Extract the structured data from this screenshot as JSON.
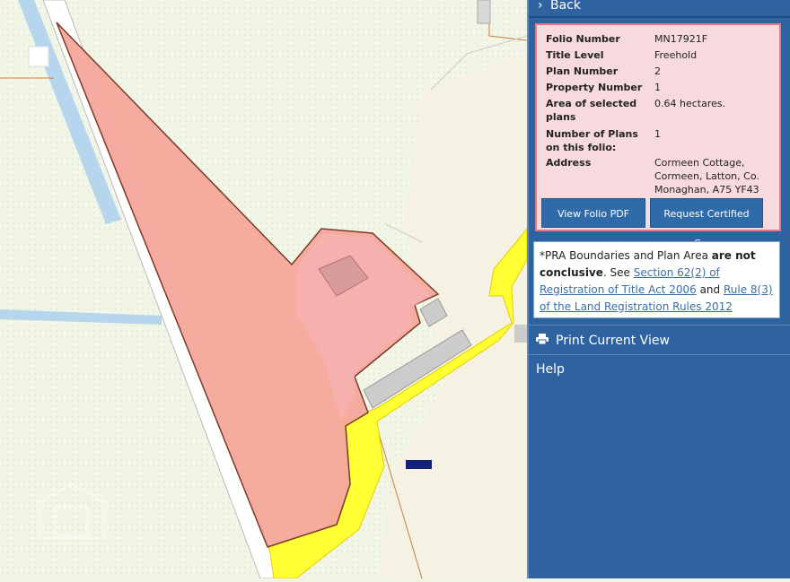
{
  "panel": {
    "back_label": "Back",
    "folio": [
      {
        "label": "Folio Number",
        "value": "MN17921F"
      },
      {
        "label": "Title Level",
        "value": "Freehold"
      },
      {
        "label": "Plan Number",
        "value": "2"
      },
      {
        "label": "Property Number",
        "value": "1"
      },
      {
        "label": "Area of selected plans",
        "value": "0.64 hectares."
      },
      {
        "label": "Number of Plans on this folio:",
        "value": "1"
      },
      {
        "label": "Address",
        "value": "Cormeen Cottage, Cormeen, Latton, Co. Monaghan, A75 YF43"
      }
    ],
    "view_pdf_label": "View Folio PDF",
    "request_copy_label": "Request Certified Copy",
    "notice": {
      "prefix": "*PRA Boundaries and Plan Area ",
      "bold": "are not conclusive",
      "mid": ". See ",
      "link1": "Section 62(2) of Registration of Title Act 2006",
      "and": " and ",
      "link2": "Rule 8(3) of the Land Registration Rules 2012"
    },
    "print_label": "Print Current View",
    "help_label": "Help"
  },
  "colors": {
    "panel_bg": "#2f639f",
    "parcel_fill": "#f4a79a",
    "road_yellow": "#ffff33",
    "info_bg": "#f7dadd"
  },
  "icons": [
    "chevron-right-icon",
    "printer-icon",
    "watermark-logo"
  ]
}
